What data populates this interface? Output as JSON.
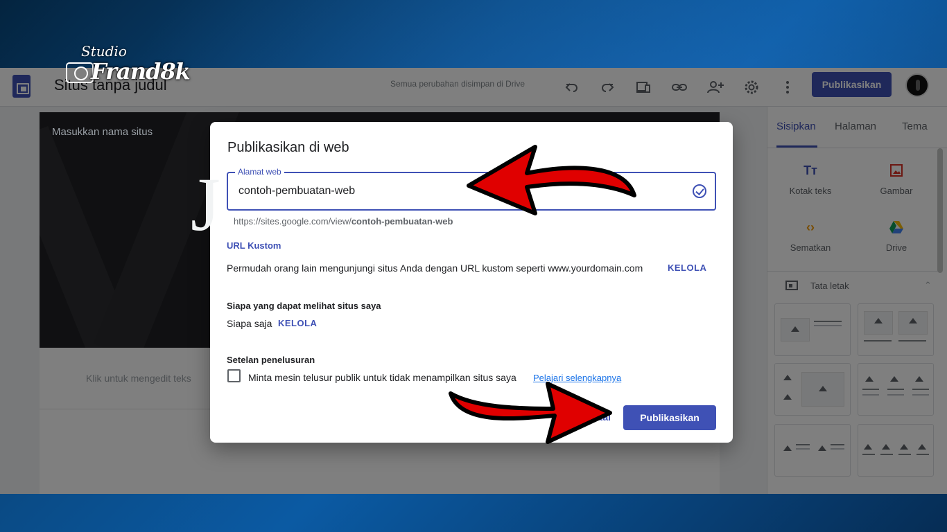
{
  "header": {
    "site_title": "Situs tanpa judul",
    "save_status": "Semua perubahan disimpan di Drive",
    "publish_label": "Publikasikan",
    "icons": [
      "undo-icon",
      "redo-icon",
      "device-preview-icon",
      "link-icon",
      "share-icon",
      "gear-icon",
      "more-vert-icon"
    ]
  },
  "canvas": {
    "site_name_placeholder": "Masukkan nama situs",
    "banner_letter": "J",
    "edit_text_placeholder": "Klik untuk mengedit teks"
  },
  "side_panel": {
    "tabs": [
      "Sisipkan",
      "Halaman",
      "Tema"
    ],
    "insert_items": [
      {
        "label": "Kotak teks",
        "icon": "text-box-icon"
      },
      {
        "label": "Gambar",
        "icon": "image-icon"
      },
      {
        "label": "Sematkan",
        "icon": "embed-icon"
      },
      {
        "label": "Drive",
        "icon": "drive-icon"
      }
    ],
    "layout_label": "Tata letak"
  },
  "dialog": {
    "title": "Publikasikan di web",
    "address_label": "Alamat web",
    "address_value": "contoh-pembuatan-web",
    "url_prefix": "https://sites.google.com/view/",
    "url_slug": "contoh-pembuatan-web",
    "custom_url_title": "URL Kustom",
    "custom_url_desc": "Permudah orang lain mengunjungi situs Anda dengan URL kustom seperti www.yourdomain.com",
    "manage_label": "KELOLA",
    "visibility_title": "Siapa yang dapat melihat situs saya",
    "visibility_value": "Siapa saja",
    "search_title": "Setelan penelusuran",
    "search_checkbox_label": "Minta mesin telusur publik untuk tidak menampilkan situs saya",
    "learn_more": "Pelajari selengkapnya",
    "cancel_label": "Batal",
    "publish_label": "Publikasikan"
  },
  "watermark": {
    "line1": "Studio",
    "line2": "Frand8k"
  },
  "colors": {
    "accent": "#3f51b5",
    "annotation_arrow": "#e00000"
  }
}
